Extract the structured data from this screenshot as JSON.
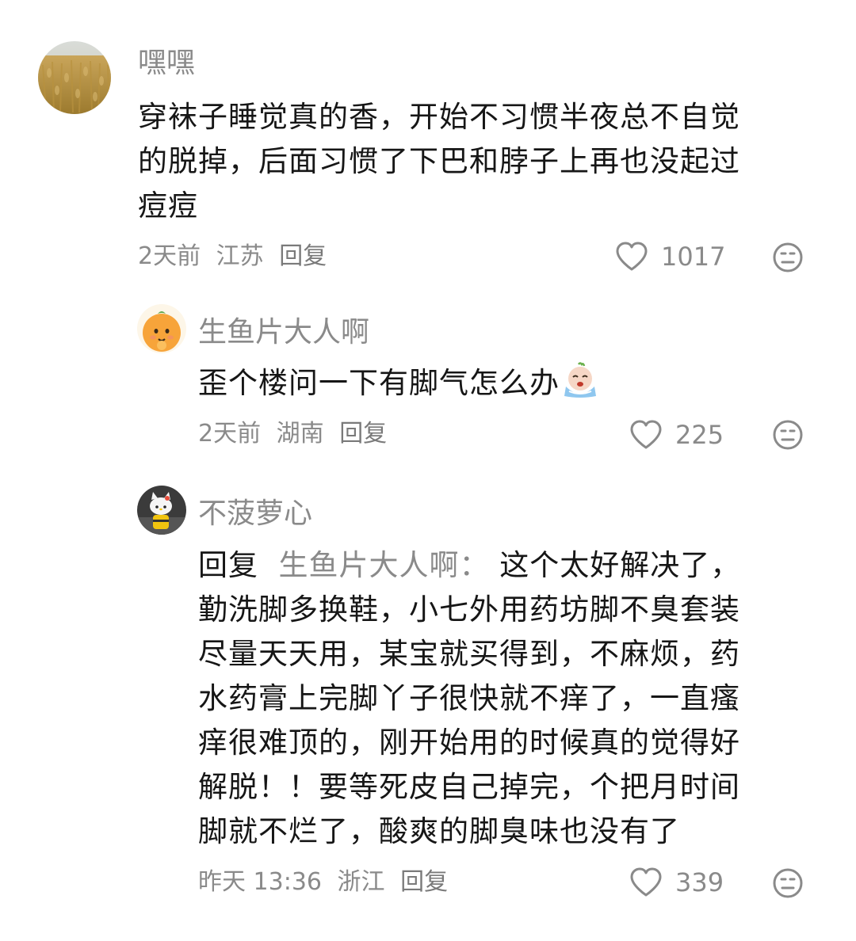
{
  "comments": [
    {
      "author": "嘿嘿",
      "avatar": "wheat-field-avatar",
      "lines": [
        "穿袜子睡觉真的香，开始不习惯半夜总不自觉",
        "的脱掉，后面习惯了下巴和脖子上再也没起过",
        "痘痘"
      ],
      "time": "2天前",
      "location": "江苏",
      "reply_label": "回复",
      "likes": "1017"
    },
    {
      "author": "生鱼片大人啊",
      "avatar": "orange-cartoon-avatar",
      "lines": [
        "歪个楼问一下有脚气怎么办"
      ],
      "emoji": "crying-emoji",
      "time": "2天前",
      "location": "湖南",
      "reply_label": "回复",
      "likes": "225"
    },
    {
      "author": "不菠萝心",
      "avatar": "hello-kitty-avatar",
      "reply_prefix": "回复",
      "reply_to": "生鱼片大人啊：",
      "first_line_rest": "这个太好解决了，",
      "lines": [
        "勤洗脚多换鞋，小七外用药坊脚不臭套装",
        "尽量天天用，某宝就买得到，不麻烦，药",
        "水药膏上完脚丫子很快就不痒了，一直瘙",
        "痒很难顶的，刚开始用的时候真的觉得好",
        "解脱！！要等死皮自己掉完，个把月时间",
        "脚就不烂了，酸爽的脚臭味也没有了"
      ],
      "time": "昨天 13:36",
      "location": "浙江",
      "reply_label": "回复",
      "likes": "339"
    }
  ],
  "icons": {
    "like": "heart-outline-icon",
    "dislike": "meh-face-icon"
  },
  "colors": {
    "text": "#161616",
    "muted": "#8a8a8a"
  }
}
